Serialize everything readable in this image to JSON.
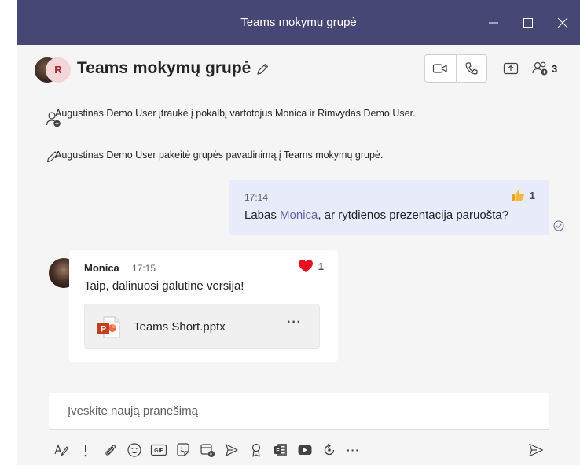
{
  "window": {
    "title": "Teams mokymų grupė"
  },
  "header": {
    "chat_title": "Teams mokymų grupė",
    "avatar_initial": "R",
    "participants_count": "3",
    "icons": [
      "edit-icon",
      "video-call-icon",
      "audio-call-icon",
      "share-screen-icon",
      "people-icon"
    ]
  },
  "messages": {
    "system": [
      {
        "icon": "add-person-icon",
        "text": "Augustinas Demo User įtraukė į pokalbį vartotojus Monica ir Rimvydas Demo User."
      },
      {
        "icon": "pencil-icon",
        "text": "Augustinas Demo User pakeitė grupės pavadinimą į Teams mokymų grupė."
      }
    ],
    "mine": {
      "time": "17:14",
      "text_before": "Labas ",
      "mention": "Monica",
      "text_after": ", ar rytdienos prezentacija paruošta?",
      "reaction_icon": "thumbs-up-icon",
      "reaction_count": "1"
    },
    "other": {
      "sender": "Monica",
      "time": "17:15",
      "text": "Taip, dalinuosi galutine versija!",
      "reaction_icon": "heart-icon",
      "reaction_count": "1",
      "attachment": {
        "file_name": "Teams Short.pptx",
        "icon": "powerpoint-icon",
        "more": "···"
      }
    }
  },
  "compose": {
    "placeholder": "Įveskite naują pranešimą"
  },
  "toolbar": {
    "icons": [
      "format-icon",
      "important-icon",
      "attach-icon",
      "emoji-icon",
      "gif-icon",
      "sticker-icon",
      "meet-now-icon",
      "send-forward-icon",
      "praise-icon",
      "forms-icon",
      "youtube-icon",
      "loop-icon",
      "more-icon"
    ],
    "gif_label": "GIF",
    "more_label": "···"
  },
  "colors": {
    "titlebar": "#464775",
    "accent": "#6264a7",
    "mine_bubble": "#e8ebfa",
    "heart": "#e81123",
    "thumbs": "#f7b63c",
    "presence": "#6bb700",
    "ppt": "#c43e1c"
  }
}
